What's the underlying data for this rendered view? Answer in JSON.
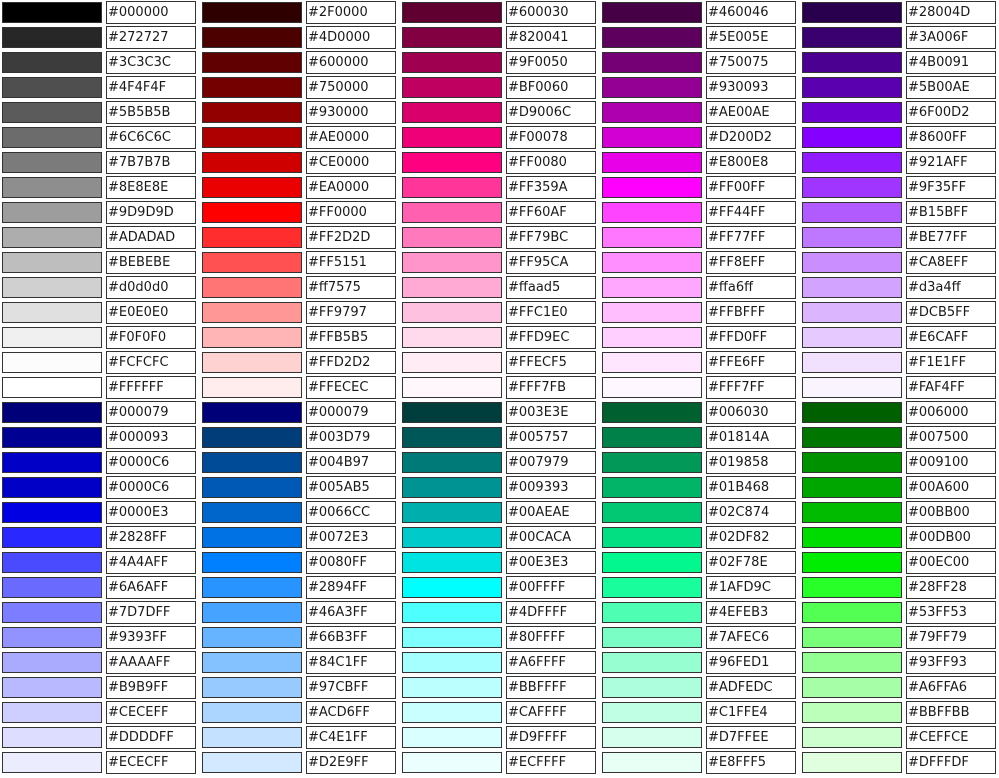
{
  "groups": [
    {
      "columns": [
        [
          "#000000",
          "#272727",
          "#3C3C3C",
          "#4F4F4F",
          "#5B5B5B",
          "#6C6C6C",
          "#7B7B7B",
          "#8E8E8E",
          "#9D9D9D",
          "#ADADAD",
          "#BEBEBE",
          "#d0d0d0",
          "#E0E0E0",
          "#F0F0F0",
          "#FCFCFC",
          "#FFFFFF"
        ],
        [
          "#2F0000",
          "#4D0000",
          "#600000",
          "#750000",
          "#930000",
          "#AE0000",
          "#CE0000",
          "#EA0000",
          "#FF0000",
          "#FF2D2D",
          "#FF5151",
          "#ff7575",
          "#FF9797",
          "#FFB5B5",
          "#FFD2D2",
          "#FFECEC"
        ],
        [
          "#600030",
          "#820041",
          "#9F0050",
          "#BF0060",
          "#D9006C",
          "#F00078",
          "#FF0080",
          "#FF359A",
          "#FF60AF",
          "#FF79BC",
          "#FF95CA",
          "#ffaad5",
          "#FFC1E0",
          "#FFD9EC",
          "#FFECF5",
          "#FFF7FB"
        ],
        [
          "#460046",
          "#5E005E",
          "#750075",
          "#930093",
          "#AE00AE",
          "#D200D2",
          "#E800E8",
          "#FF00FF",
          "#FF44FF",
          "#FF77FF",
          "#FF8EFF",
          "#ffa6ff",
          "#FFBFFF",
          "#FFD0FF",
          "#FFE6FF",
          "#FFF7FF"
        ],
        [
          "#28004D",
          "#3A006F",
          "#4B0091",
          "#5B00AE",
          "#6F00D2",
          "#8600FF",
          "#921AFF",
          "#9F35FF",
          "#B15BFF",
          "#BE77FF",
          "#CA8EFF",
          "#d3a4ff",
          "#DCB5FF",
          "#E6CAFF",
          "#F1E1FF",
          "#FAF4FF"
        ]
      ]
    },
    {
      "columns": [
        [
          "#000079",
          "#000093",
          "#0000C6",
          "#0000C6",
          "#0000E3",
          "#2828FF",
          "#4A4AFF",
          "#6A6AFF",
          "#7D7DFF",
          "#9393FF",
          "#AAAAFF",
          "#B9B9FF",
          "#CECEFF",
          "#DDDDFF",
          "#ECECFF"
        ],
        [
          "#000079",
          "#003D79",
          "#004B97",
          "#005AB5",
          "#0066CC",
          "#0072E3",
          "#0080FF",
          "#2894FF",
          "#46A3FF",
          "#66B3FF",
          "#84C1FF",
          "#97CBFF",
          "#ACD6FF",
          "#C4E1FF",
          "#D2E9FF"
        ],
        [
          "#003E3E",
          "#005757",
          "#007979",
          "#009393",
          "#00AEAE",
          "#00CACA",
          "#00E3E3",
          "#00FFFF",
          "#4DFFFF",
          "#80FFFF",
          "#A6FFFF",
          "#BBFFFF",
          "#CAFFFF",
          "#D9FFFF",
          "#ECFFFF"
        ],
        [
          "#006030",
          "#01814A",
          "#019858",
          "#01B468",
          "#02C874",
          "#02DF82",
          "#02F78E",
          "#1AFD9C",
          "#4EFEB3",
          "#7AFEC6",
          "#96FED1",
          "#ADFEDC",
          "#C1FFE4",
          "#D7FFEE",
          "#E8FFF5"
        ],
        [
          "#006000",
          "#007500",
          "#009100",
          "#00A600",
          "#00BB00",
          "#00DB00",
          "#00EC00",
          "#28FF28",
          "#53FF53",
          "#79FF79",
          "#93FF93",
          "#A6FFA6",
          "#BBFFBB",
          "#CEFFCE",
          "#DFFFDF"
        ]
      ]
    }
  ]
}
